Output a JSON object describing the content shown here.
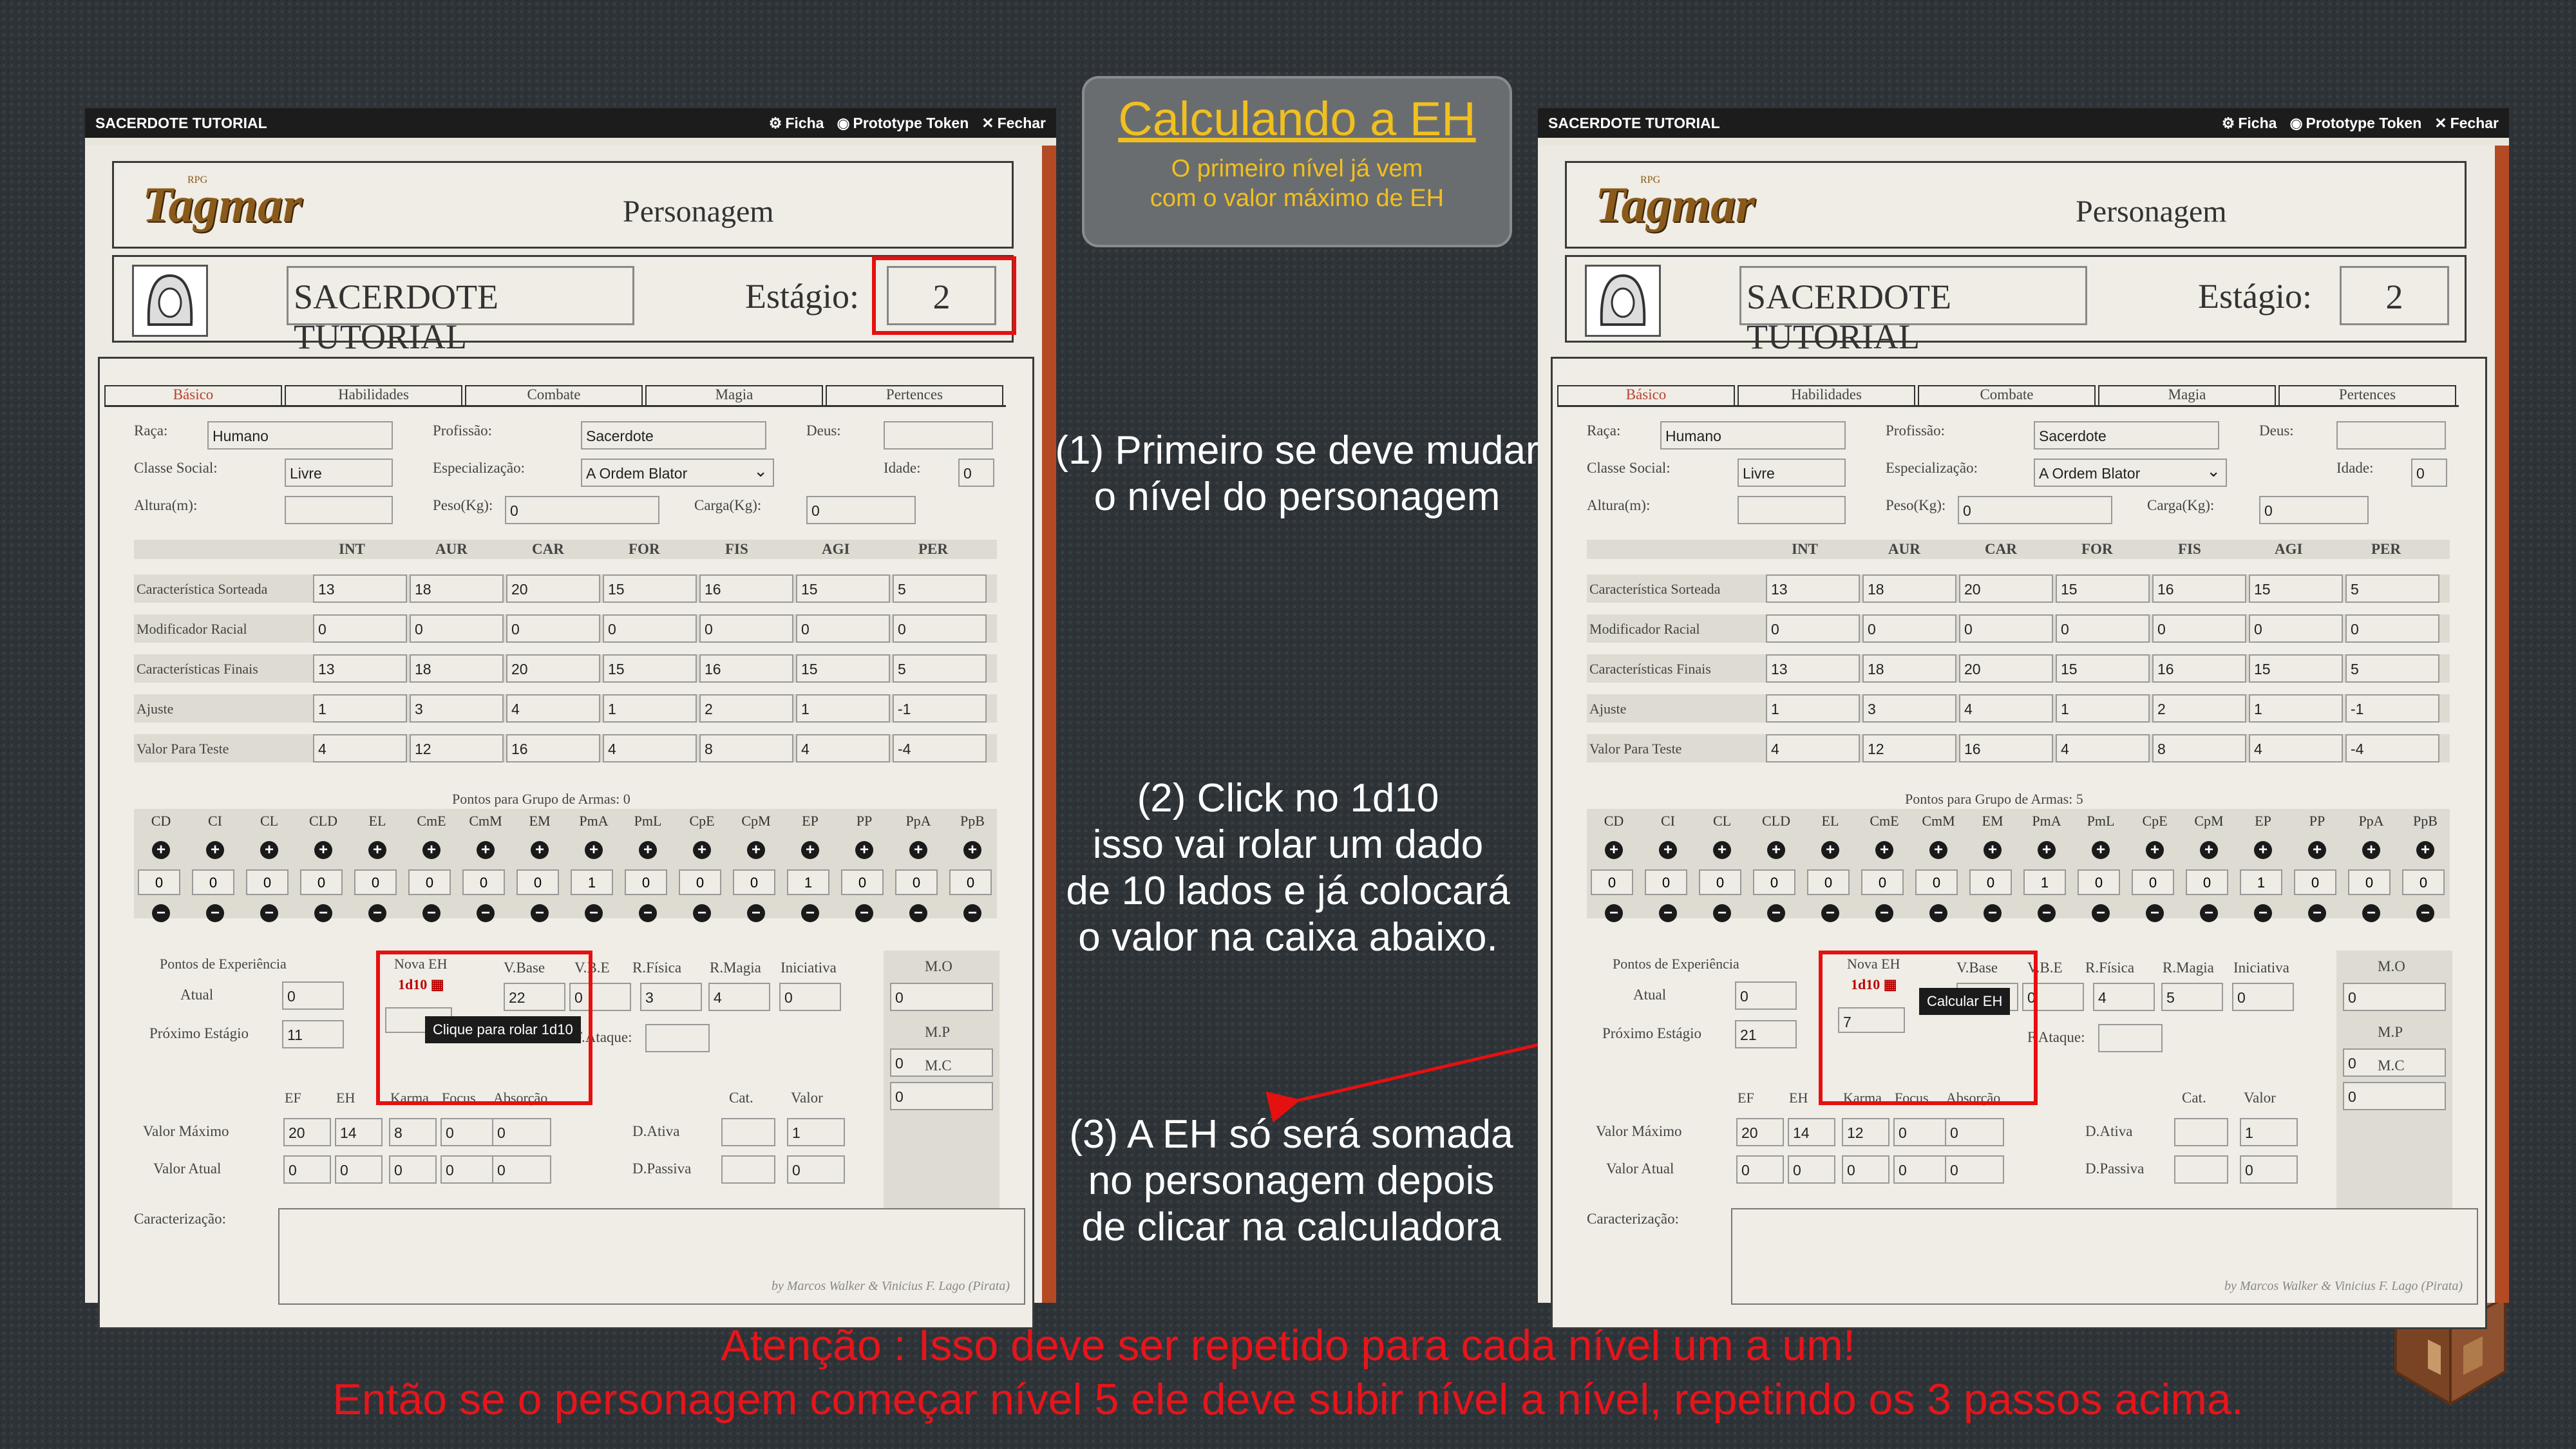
{
  "banner": {
    "title": "Calculando a EH",
    "subtitle_line1": "O primeiro nível já vem",
    "subtitle_line2": "com o valor máximo de EH"
  },
  "notes": {
    "step1_line1": "(1) Primeiro se deve mudar",
    "step1_line2": "o nível do personagem",
    "step2_line1": "(2) Click no 1d10",
    "step2_line2": "isso vai rolar um dado",
    "step2_line3": "de 10 lados e já colocará",
    "step2_line4": "o valor na caixa abaixo.",
    "step3_line1": "(3) A EH só será somada",
    "step3_line2": "no personagem depois",
    "step3_line3": "de clicar na calculadora"
  },
  "warning": {
    "line1": "Atenção : Isso deve ser repetido para cada nível um a um!",
    "line2": "Então se o personagem começar nível 5 ele deve subir nível a nível, repetindo os 3 passos acima."
  },
  "window": {
    "title": "SACERDOTE TUTORIAL",
    "btn_ficha": "Ficha",
    "btn_token": "Prototype Token",
    "btn_fechar": "Fechar"
  },
  "sheet": {
    "logo_small": "RPG",
    "logo": "Tagmar",
    "header_title": "Personagem",
    "char_name": "SACERDOTE TUTORIAL",
    "estagio_label": "Estágio:",
    "tabs": [
      "Básico",
      "Habilidades",
      "Combate",
      "Magia",
      "Pertences"
    ],
    "raca_label": "Raça:",
    "raca": "Humano",
    "profissao_label": "Profissão:",
    "profissao": "Sacerdote",
    "deus_label": "Deus:",
    "classe_label": "Classe Social:",
    "classe": "Livre",
    "especializacao_label": "Especialização:",
    "especializacao": "A Ordem Blator",
    "idade_label": "Idade:",
    "idade": "0",
    "altura_label": "Altura(m):",
    "peso_label": "Peso(Kg):",
    "peso": "0",
    "carga_label": "Carga(Kg):",
    "carga": "0",
    "attr_headers": [
      "INT",
      "AUR",
      "CAR",
      "FOR",
      "FIS",
      "AGI",
      "PER"
    ],
    "attr_rows": [
      {
        "label": "Característica Sorteada",
        "values": [
          "13",
          "18",
          "20",
          "15",
          "16",
          "15",
          "5"
        ]
      },
      {
        "label": "Modificador Racial",
        "values": [
          "0",
          "0",
          "0",
          "0",
          "0",
          "0",
          "0"
        ]
      },
      {
        "label": "Características Finais",
        "values": [
          "13",
          "18",
          "20",
          "15",
          "16",
          "15",
          "5"
        ]
      },
      {
        "label": "Ajuste",
        "values": [
          "1",
          "3",
          "4",
          "1",
          "2",
          "1",
          "-1"
        ]
      },
      {
        "label": "Valor Para Teste",
        "values": [
          "4",
          "12",
          "16",
          "4",
          "8",
          "4",
          "-4"
        ]
      }
    ],
    "weapon_groups": [
      "CD",
      "CI",
      "CL",
      "CLD",
      "EL",
      "CmE",
      "CmM",
      "EM",
      "PmA",
      "PmL",
      "CpE",
      "CpM",
      "EP",
      "PP",
      "PpA",
      "PpB"
    ],
    "weapon_values": [
      "0",
      "0",
      "0",
      "0",
      "0",
      "0",
      "0",
      "0",
      "1",
      "0",
      "0",
      "0",
      "1",
      "0",
      "0",
      "0"
    ],
    "exp_label": "Pontos de Experiência",
    "atual_label": "Atual",
    "atual": "0",
    "proximo_label": "Próximo Estágio",
    "nova_eh_label": "Nova EH",
    "dice_label": "1d10",
    "vbase_label": "V.Base",
    "vbe_label": "V.B.E",
    "rfisica_label": "R.Física",
    "rmagia_label": "R.Magia",
    "iniciativa_label": "Iniciativa",
    "fataque_label": "F.Ataque:",
    "mo_label": "M.O",
    "mo": "0",
    "mp_label": "M.P",
    "mp": "0",
    "mc_label": "M.C",
    "mc": "0",
    "ef_headers": [
      "EF",
      "EH",
      "Karma",
      "Focus",
      "Absorção"
    ],
    "valor_max_label": "Valor Máximo",
    "valor_atual_label": "Valor Atual",
    "valor_atual": [
      "0",
      "0",
      "0",
      "0",
      "0"
    ],
    "cat_label": "Cat.",
    "valor_label": "Valor",
    "dativa_label": "D.Ativa",
    "dativa": "1",
    "dpassiva_label": "D.Passiva",
    "dpassiva": "0",
    "caracterizacao_label": "Caracterização:",
    "credit": "by Marcos Walker & Vinicius F. Lago (Pirata)"
  },
  "left": {
    "estagio": "2",
    "weapon_points": "Pontos para Grupo de Armas: 0",
    "proximo": "11",
    "vbase": "22",
    "vbe": "0",
    "rfisica": "3",
    "rmagia": "4",
    "iniciativa": "0",
    "nova_eh": "",
    "valor_max": [
      "20",
      "14",
      "8",
      "0",
      "0"
    ],
    "tooltip": "Clique para rolar 1d10"
  },
  "right": {
    "estagio": "2",
    "weapon_points": "Pontos para Grupo de Armas: 5",
    "proximo": "21",
    "vbase": "",
    "vbe": "0",
    "rfisica": "4",
    "rmagia": "5",
    "iniciativa": "0",
    "nova_eh": "7",
    "valor_max": [
      "20",
      "14",
      "12",
      "0",
      "0"
    ],
    "tooltip": "Calcular EH"
  }
}
